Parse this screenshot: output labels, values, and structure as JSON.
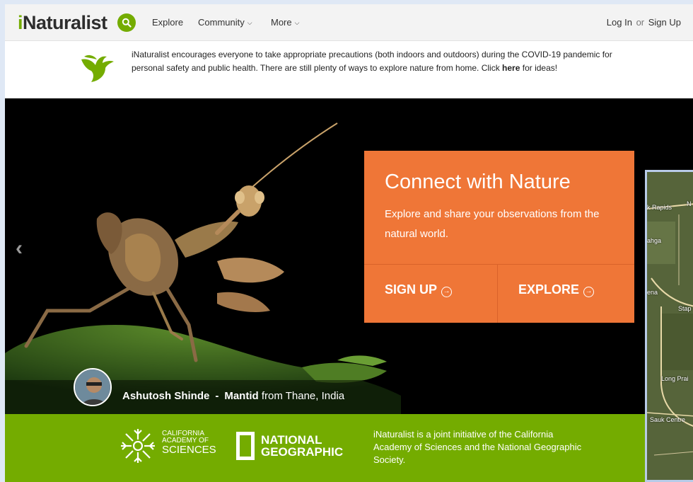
{
  "header": {
    "logo": {
      "prefix": "i",
      "rest": "Naturalist"
    },
    "nav": [
      {
        "label": "Explore"
      },
      {
        "label": "Community",
        "icon": "chevron-down-icon"
      },
      {
        "label": "More",
        "icon": "chevron-down-icon"
      }
    ],
    "auth": {
      "login": "Log In",
      "or": "or",
      "signup": "Sign Up"
    }
  },
  "banner": {
    "text_before": "iNaturalist encourages everyone to take appropriate precautions (both indoors and outdoors) during the COVID-19 pandemic for personal safety and public health. There are still plenty of ways to explore nature from home. Click ",
    "link": "here",
    "text_after": " for ideas!",
    "icon": "bird-icon"
  },
  "hero": {
    "title": "Connect with Nature",
    "subtitle": "Explore and share your observations from the natural world.",
    "signup_label": "SIGN UP",
    "explore_label": "EXPLORE",
    "photo_credit": {
      "name": "Ashutosh Shinde",
      "separator": "-",
      "taxon": "Mantid",
      "place": " from Thane, India"
    }
  },
  "map": {
    "labels": [
      "k Rapids",
      "N",
      "ahga",
      "ena",
      "Stap",
      "Long Prai",
      "Sauk Centre"
    ]
  },
  "partners": {
    "cas": {
      "line1": "CALIFORNIA",
      "line2": "ACADEMY OF",
      "line3": "SCIENCES"
    },
    "natgeo": {
      "line1": "NATIONAL",
      "line2": "GEOGRAPHIC"
    },
    "blurb": "iNaturalist is a joint initiative of the California Academy of Sciences and the National Geographic Society."
  },
  "colors": {
    "brand_green": "#74ac00",
    "cta_orange": "#ef7637"
  }
}
